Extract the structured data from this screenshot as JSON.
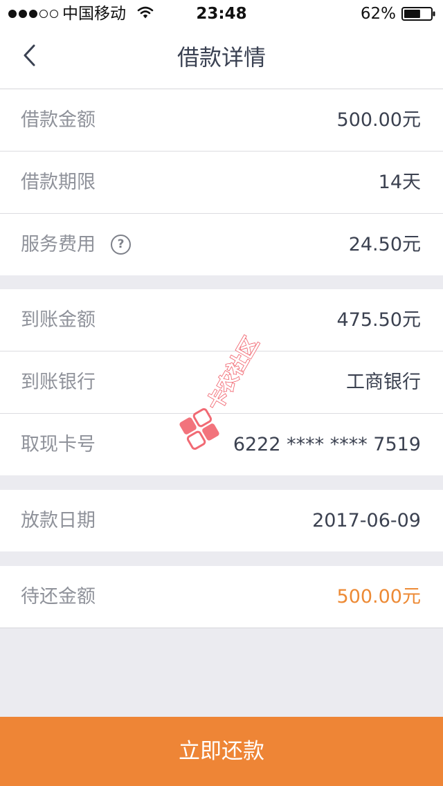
{
  "status_bar": {
    "signal_bars_filled": 3,
    "signal_bars_total": 5,
    "carrier": "中国移动",
    "time": "23:48",
    "battery_pct": "62%",
    "battery_level": 0.62
  },
  "nav": {
    "back_icon": "chevron-left-icon",
    "title": "借款详情"
  },
  "details": {
    "group1": [
      {
        "label": "借款金额",
        "value": "500.00元"
      },
      {
        "label": "借款期限",
        "value": "14天"
      },
      {
        "label": "服务费用",
        "value": "24.50元",
        "help_icon": "?"
      }
    ],
    "group2": [
      {
        "label": "到账金额",
        "value": "475.50元"
      },
      {
        "label": "到账银行",
        "value": "工商银行"
      },
      {
        "label": "取现卡号",
        "value": "6222 **** **** 7519"
      }
    ],
    "group3": [
      {
        "label": "放款日期",
        "value": "2017-06-09"
      }
    ],
    "group4": [
      {
        "label": "待还金额",
        "value": "500.00元"
      }
    ]
  },
  "watermark": {
    "text": "卡农社区"
  },
  "actions": {
    "repay_label": "立即还款"
  },
  "colors": {
    "accent": "#ee8536",
    "amount_due": "#ed8a35",
    "label_gray": "#8f929a",
    "value_dark": "#3b4150",
    "background": "#ebebf0"
  }
}
